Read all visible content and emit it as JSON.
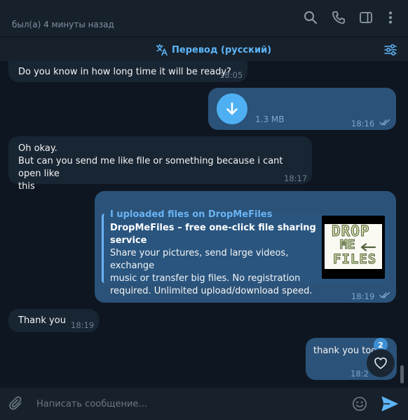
{
  "header": {
    "status": "был(а) 4 минуты назад",
    "icons": [
      "search-icon",
      "phone-icon",
      "sidebar-toggle-icon",
      "more-vertical-icon"
    ]
  },
  "translate_bar": {
    "label": "Перевод (русский)",
    "icon": "translate-icon",
    "settings_icon": "filter-settings-icon"
  },
  "messages": [
    {
      "direction": "incoming",
      "text": "Do you know in how long time it will be ready?",
      "time": "18:05"
    },
    {
      "direction": "outgoing",
      "type": "file",
      "file_size": "1.3 MB",
      "time": "18:16",
      "read": true
    },
    {
      "direction": "incoming",
      "lines": [
        "Oh okay.",
        "But can you send me like file or something because i cant open like",
        "this"
      ],
      "time": "18:17"
    },
    {
      "direction": "outgoing",
      "type": "link",
      "text": "I uploaded files on DropMeFiles",
      "preview": {
        "site": "DropMeFiles",
        "title": "DropMeFiles – free one-click file sharing service",
        "description_lines": [
          "Share your pictures, send large videos, exchange",
          "music or transfer big files. No registration",
          "required. Unlimited upload/download speed."
        ],
        "thumbnail_words": [
          "DROP",
          "ME",
          "FILES"
        ]
      },
      "time": "18:19",
      "read": true
    },
    {
      "direction": "incoming",
      "text": "Thank you",
      "time": "18:19"
    },
    {
      "direction": "outgoing",
      "text": "thank you too",
      "time": "18:2",
      "reaction": {
        "emoji": "heart-icon",
        "count": "2"
      }
    }
  ],
  "input": {
    "placeholder": "Написать сообщение...",
    "icons": [
      "attach-icon",
      "emoji-icon",
      "send-icon"
    ]
  },
  "colors": {
    "background": "#0e1621",
    "header": "#17212b",
    "incoming_bubble": "#182533",
    "outgoing_bubble": "#2b5278",
    "accent": "#5eb5f7"
  }
}
